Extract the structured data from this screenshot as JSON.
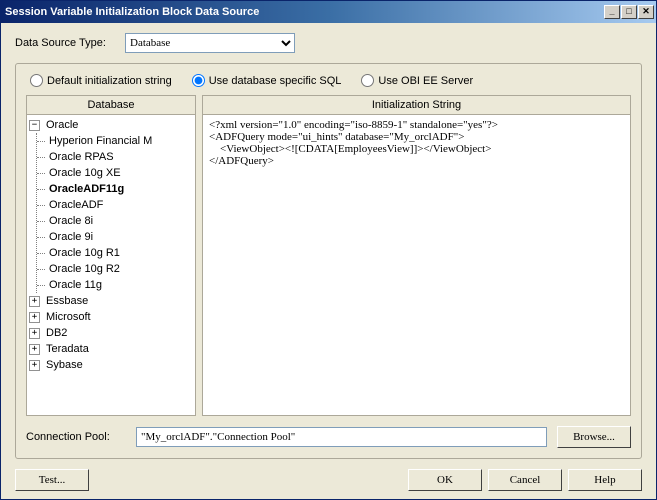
{
  "window": {
    "title": "Session Variable Initialization Block Data Source",
    "minimize_btn": "_",
    "maximize_btn": "□",
    "close_btn": "✕"
  },
  "data_source_type": {
    "label": "Data Source Type:",
    "value": "Database"
  },
  "radios": {
    "default": "Default initialization string",
    "dbspecific": "Use database specific SQL",
    "obiee": "Use OBI EE Server",
    "selected": "dbspecific"
  },
  "left_panel": {
    "header": "Database"
  },
  "right_panel": {
    "header": "Initialization String"
  },
  "tree": {
    "root": "Oracle",
    "children": [
      "Hyperion Financial M",
      "Oracle RPAS",
      "Oracle 10g XE",
      "OracleADF11g",
      "OracleADF",
      "Oracle 8i",
      "Oracle 9i",
      "Oracle 10g R1",
      "Oracle 10g R2",
      "Oracle 11g"
    ],
    "selected_index": 3,
    "siblings": [
      "Essbase",
      "Microsoft",
      "DB2",
      "Teradata",
      "Sybase"
    ]
  },
  "init_string": "<?xml version=\"1.0\" encoding=\"iso-8859-1\" standalone=\"yes\"?>\n<ADFQuery mode=\"ui_hints\" database=\"My_orclADF\">\n    <ViewObject><![CDATA[EmployeesView]]></ViewObject>\n</ADFQuery>",
  "connection_pool": {
    "label": "Connection Pool:",
    "value": "\"My_orclADF\".\"Connection Pool\"",
    "browse": "Browse..."
  },
  "buttons": {
    "test": "Test...",
    "ok": "OK",
    "cancel": "Cancel",
    "help": "Help"
  }
}
